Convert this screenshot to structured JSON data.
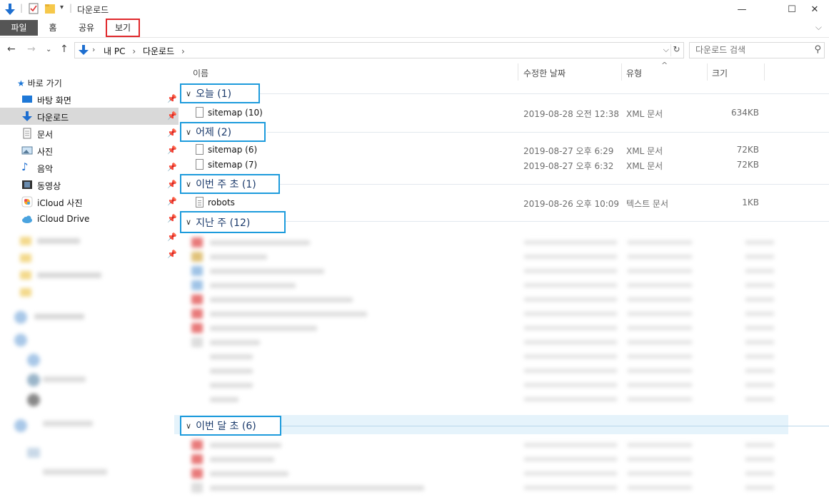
{
  "window": {
    "title": "다운로드",
    "minimize": "—",
    "maximize": "☐",
    "close": "✕"
  },
  "ribbon": {
    "tabs": [
      "파일",
      "홈",
      "공유",
      "보기"
    ],
    "collapse_icon": "chevron-down-icon",
    "highlight_color": "#e0282b"
  },
  "address": {
    "crumbs": [
      "내 PC",
      "다운로드"
    ],
    "search_placeholder": "다운로드 검색"
  },
  "sidebar": {
    "quick_access": "바로 가기",
    "items": [
      {
        "label": "바탕 화면",
        "icon": "desktop-icon",
        "pinned": true
      },
      {
        "label": "다운로드",
        "icon": "download-icon",
        "pinned": true,
        "selected": true
      },
      {
        "label": "문서",
        "icon": "document-icon",
        "pinned": true
      },
      {
        "label": "사진",
        "icon": "pictures-icon",
        "pinned": true
      },
      {
        "label": "음악",
        "icon": "music-icon",
        "pinned": true
      },
      {
        "label": "동영상",
        "icon": "video-icon",
        "pinned": true
      },
      {
        "label": "iCloud 사진",
        "icon": "icloud-photos-icon",
        "pinned": true
      },
      {
        "label": "iCloud Drive",
        "icon": "icloud-drive-icon",
        "pinned": true
      }
    ]
  },
  "columns": {
    "name": "이름",
    "date": "수정한 날짜",
    "type": "유형",
    "size": "크기"
  },
  "groups": [
    {
      "title": "오늘 (1)",
      "files": [
        {
          "name": "sitemap (10)",
          "date": "2019-08-28 오전 12:38",
          "type": "XML 문서",
          "size": "634KB",
          "icon": "file-icon"
        }
      ]
    },
    {
      "title": "어제 (2)",
      "files": [
        {
          "name": "sitemap (6)",
          "date": "2019-08-27 오후 6:29",
          "type": "XML 문서",
          "size": "72KB",
          "icon": "file-icon"
        },
        {
          "name": "sitemap (7)",
          "date": "2019-08-27 오후 6:32",
          "type": "XML 문서",
          "size": "72KB",
          "icon": "file-icon"
        }
      ]
    },
    {
      "title": "이번 주 초 (1)",
      "files": [
        {
          "name": "robots",
          "date": "2019-08-26 오후 10:09",
          "type": "텍스트 문서",
          "size": "1KB",
          "icon": "text-file-icon"
        }
      ]
    },
    {
      "title": "지난 주 (12)",
      "files": []
    },
    {
      "title": "이번 달 초 (6)",
      "files": []
    }
  ],
  "colors": {
    "group_border": "#1d9bdc",
    "group_title": "#1b3a6b",
    "selected_bg": "#d9d9d9",
    "band_bg": "#e5f3fb"
  }
}
